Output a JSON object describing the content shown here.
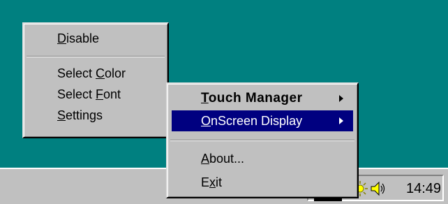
{
  "left_menu": {
    "items": [
      {
        "pre": "",
        "u": "D",
        "post": "isable"
      },
      {
        "pre": "Select ",
        "u": "C",
        "post": "olor"
      },
      {
        "pre": "Select ",
        "u": "F",
        "post": "ont"
      },
      {
        "pre": "",
        "u": "S",
        "post": "ettings"
      }
    ]
  },
  "right_menu": {
    "items": [
      {
        "pre": "",
        "u": "T",
        "post": "ouch Manager"
      },
      {
        "pre": "",
        "u": "O",
        "post": "nScreen Display"
      },
      {
        "pre": "",
        "u": "A",
        "post": "bout..."
      },
      {
        "pre": "E",
        "u": "x",
        "post": "it"
      }
    ]
  },
  "taskbar": {
    "clock": "14:49",
    "tray_icons": [
      "app-icon",
      "sun-icon",
      "speaker-icon"
    ]
  },
  "colors": {
    "desktop": "#008080",
    "menu_bg": "#c0c0c0",
    "highlight": "#000080"
  }
}
